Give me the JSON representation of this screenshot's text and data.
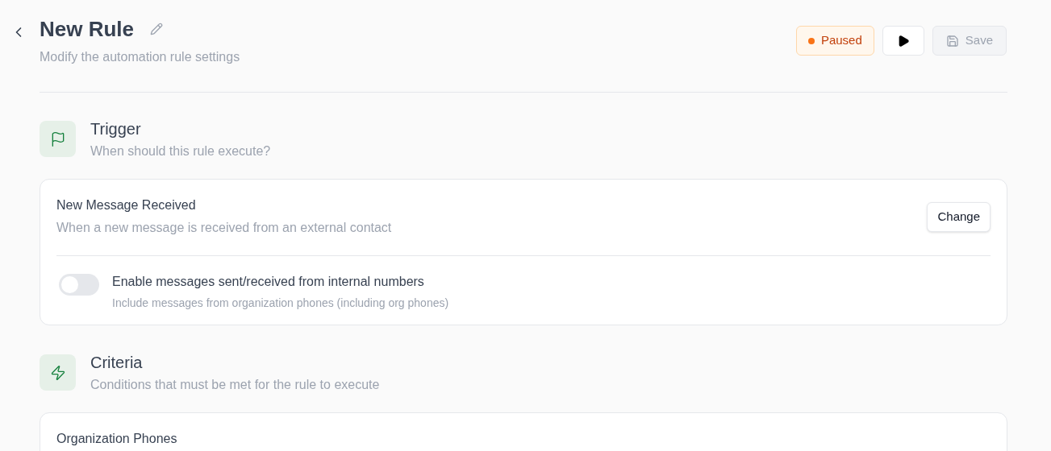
{
  "header": {
    "title": "New Rule",
    "subtitle": "Modify the automation rule settings"
  },
  "status": {
    "label": "Paused",
    "kind": "paused"
  },
  "save_button": {
    "label": "Save",
    "disabled": true
  },
  "sections": [
    {
      "kind": "trigger",
      "title": "Trigger",
      "subtitle": "When should this rule execute?",
      "card": {
        "title": "New Message Received",
        "description": "When a new message is received from an external contact",
        "action": "Change",
        "toggle": {
          "label": "Enable messages sent/received from internal numbers",
          "description": "Include messages from organization phones (including org phones)",
          "on": false
        }
      }
    },
    {
      "kind": "criteria",
      "title": "Criteria",
      "subtitle": "Conditions that must be met for the rule to execute",
      "card": {
        "title": "Organization Phones"
      }
    }
  ]
}
